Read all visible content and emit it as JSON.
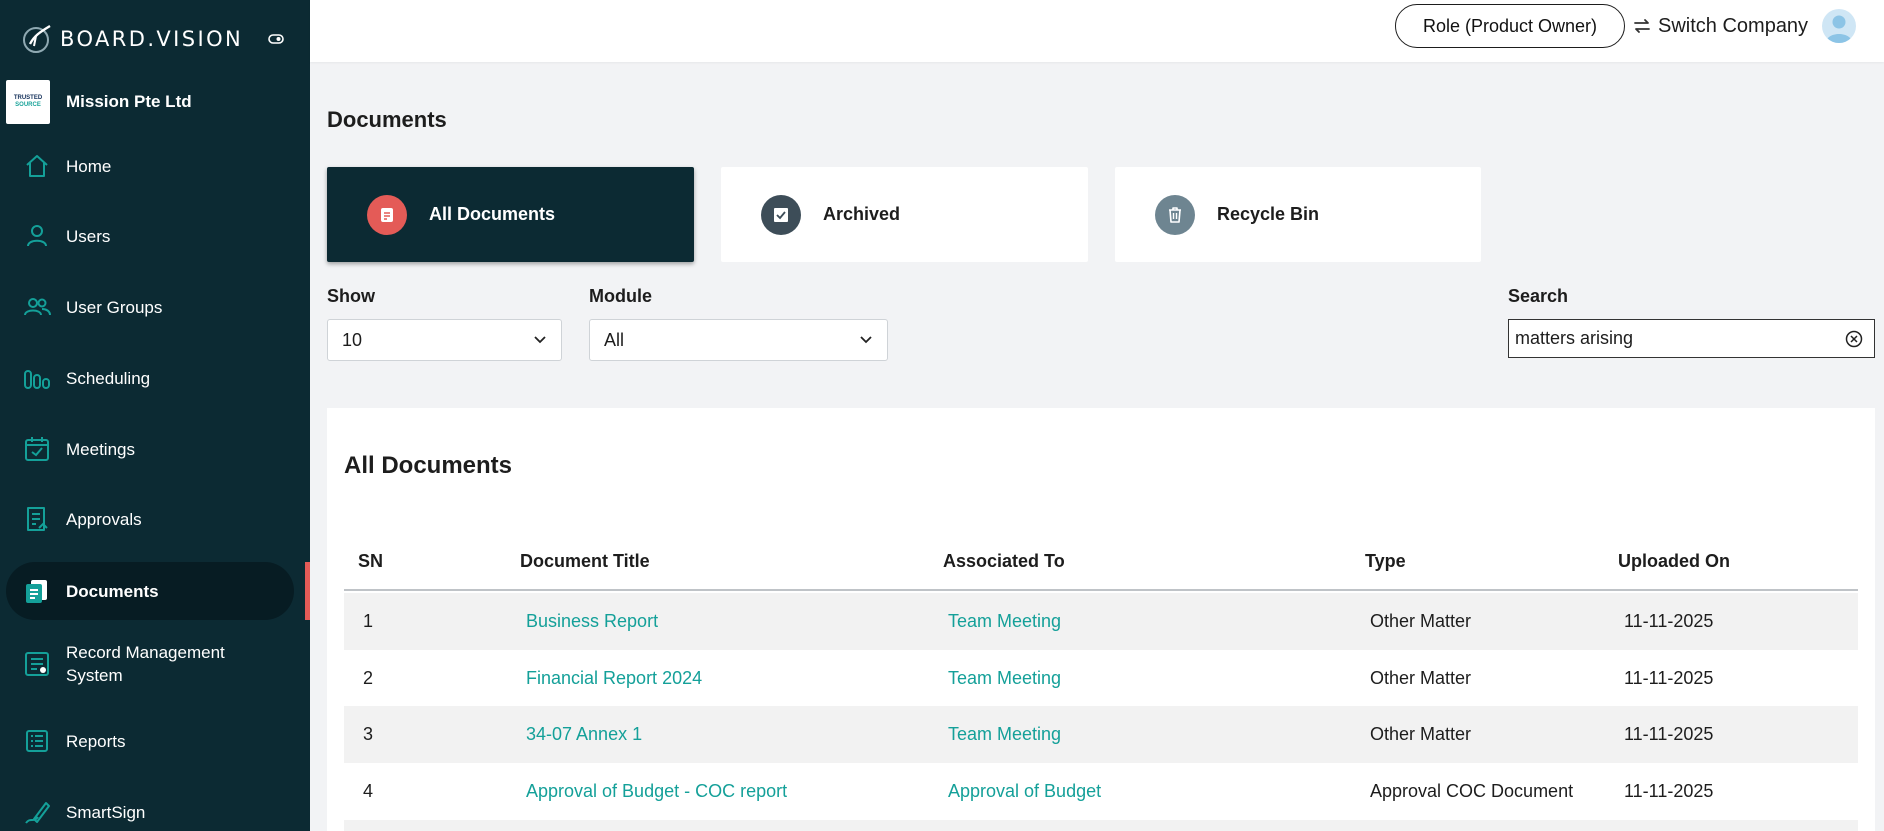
{
  "brand": {
    "name": "BOARD.VISION"
  },
  "company": {
    "name": "Mission Pte Ltd",
    "logo_line1": "TRUSTED",
    "logo_line2": "SOURCE"
  },
  "sidebar": {
    "items": [
      {
        "label": "Home",
        "icon": "home-icon"
      },
      {
        "label": "Users",
        "icon": "user-icon"
      },
      {
        "label": "User Groups",
        "icon": "user-group-icon"
      },
      {
        "label": "Scheduling",
        "icon": "scheduling-icon"
      },
      {
        "label": "Meetings",
        "icon": "calendar-check-icon"
      },
      {
        "label": "Approvals",
        "icon": "approvals-icon"
      },
      {
        "label": "Documents",
        "icon": "documents-icon",
        "active": true
      },
      {
        "label": "Record Management System",
        "icon": "record-management-icon"
      },
      {
        "label": "Reports",
        "icon": "reports-icon"
      },
      {
        "label": "SmartSign",
        "icon": "smartsign-icon"
      }
    ]
  },
  "topbar": {
    "role_label": "Role (Product Owner)",
    "switch_label": "Switch Company"
  },
  "page": {
    "title": "Documents"
  },
  "tabs": [
    {
      "label": "All Documents",
      "icon": "document-icon",
      "icon_color": "#e45b57",
      "active": true
    },
    {
      "label": "Archived",
      "icon": "archive-check-icon",
      "icon_color": "#3d4d58"
    },
    {
      "label": "Recycle Bin",
      "icon": "trash-icon",
      "icon_color": "#6e8591"
    }
  ],
  "filters": {
    "show_label": "Show",
    "show_value": "10",
    "module_label": "Module",
    "module_value": "All",
    "search_label": "Search",
    "search_value": "matters arising"
  },
  "table": {
    "title": "All Documents",
    "columns": [
      "SN",
      "Document Title",
      "Associated To",
      "Type",
      "Uploaded On"
    ],
    "rows": [
      {
        "sn": "1",
        "title": "Business Report",
        "associated": "Team Meeting",
        "type": "Other Matter",
        "uploaded": "11-11-2025"
      },
      {
        "sn": "2",
        "title": "Financial Report 2024",
        "associated": "Team Meeting",
        "type": "Other Matter",
        "uploaded": "11-11-2025"
      },
      {
        "sn": "3",
        "title": "34-07 Annex 1",
        "associated": "Team Meeting",
        "type": "Other Matter",
        "uploaded": "11-11-2025"
      },
      {
        "sn": "4",
        "title": "Approval of Budget - COC report",
        "associated": "Approval of Budget",
        "type": "Approval COC Document",
        "uploaded": "11-11-2025"
      }
    ]
  },
  "colors": {
    "sidebar_bg": "#0c2a33",
    "accent": "#14a099",
    "active_marker": "#e45b57"
  }
}
